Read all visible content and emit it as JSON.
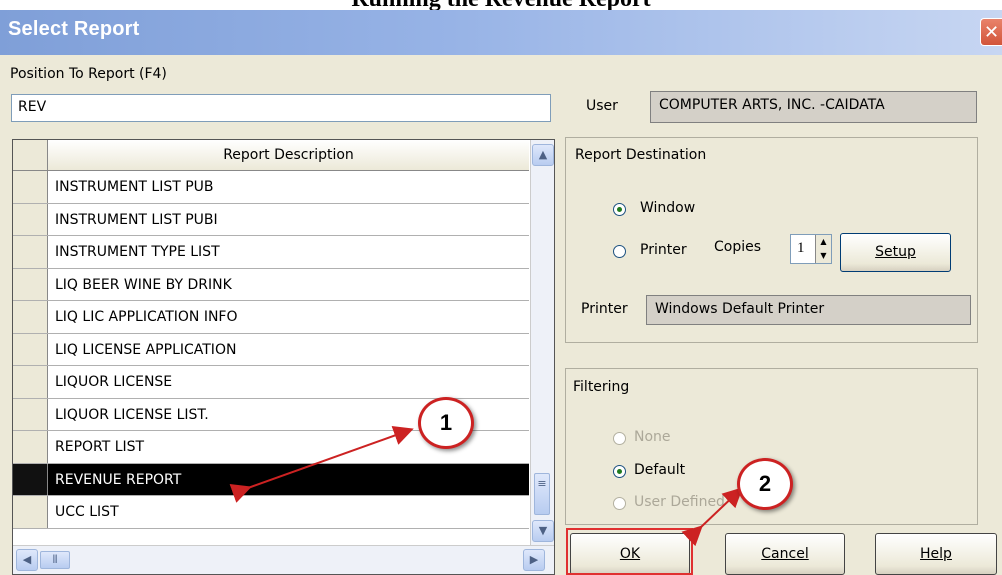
{
  "document": {
    "title": "Running the Revenue Report"
  },
  "dialog": {
    "title": "Select Report",
    "close_glyph": "✕",
    "position_label": "Position To Report (F4)",
    "position_value": "REV",
    "user_label": "User",
    "user_value": "COMPUTER ARTS, INC. -CAIDATA"
  },
  "grid": {
    "column_header": "Report Description",
    "rows": [
      "INSTRUMENT LIST PUB",
      "INSTRUMENT LIST PUBI",
      "INSTRUMENT TYPE LIST",
      "LIQ BEER WINE BY DRINK",
      "LIQ LIC APPLICATION INFO",
      "LIQ LICENSE APPLICATION",
      "LIQUOR LICENSE",
      "LIQUOR LICENSE LIST.",
      "REPORT LIST",
      "REVENUE REPORT",
      "UCC LIST"
    ],
    "selected_row": "REVENUE REPORT"
  },
  "destination": {
    "group_label": "Report Destination",
    "window_label": "Window",
    "printer_label": "Printer",
    "copies_label": "Copies",
    "copies_value": "1",
    "setup_label": "Setup",
    "printer_field_label": "Printer",
    "printer_field_value": "Windows Default Printer",
    "selected": "Window"
  },
  "filtering": {
    "group_label": "Filtering",
    "none_label": "None",
    "default_label": "Default",
    "user_defined_label": "User Defined",
    "selected": "Default"
  },
  "buttons": {
    "ok": "OK",
    "cancel": "Cancel",
    "help": "Help"
  },
  "annotations": {
    "callout1": "1",
    "callout2": "2"
  },
  "colors": {
    "titlebar": "#7f9fd8",
    "annotation_red": "#cc2222",
    "selected_row": "#000000"
  },
  "icons": [
    "close-icon",
    "scroll-up-icon",
    "scroll-down-icon",
    "scroll-left-icon",
    "scroll-right-icon",
    "spin-up-icon",
    "spin-down-icon"
  ]
}
